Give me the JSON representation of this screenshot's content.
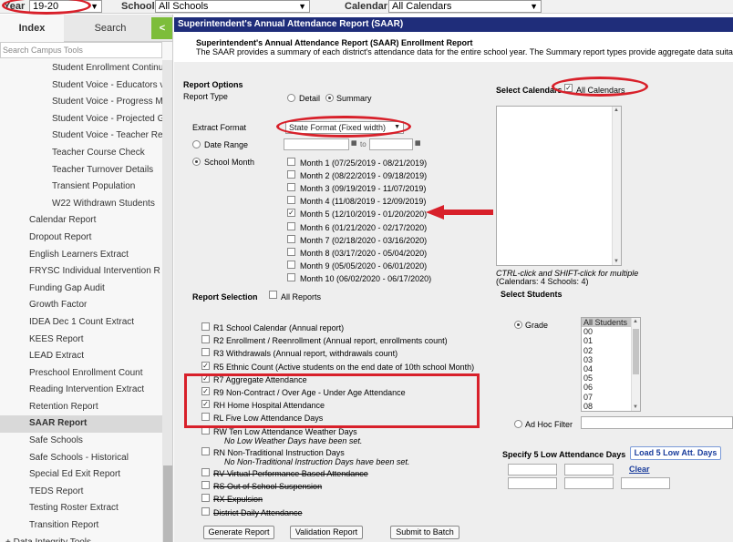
{
  "topbar": {
    "year_label": "Year",
    "year_value": "19-20",
    "school_label": "School",
    "school_value": "All Schools",
    "calendar_label": "Calendar",
    "calendar_value": "All Calendars"
  },
  "sidebar": {
    "tab_index": "Index",
    "tab_search": "Search",
    "collapse_glyph": "<",
    "search_placeholder": "Search Campus Tools",
    "items": [
      {
        "label": "Student Enrollment Continu",
        "level": 2
      },
      {
        "label": "Student Voice - Educators v",
        "level": 2
      },
      {
        "label": "Student Voice - Progress M",
        "level": 2
      },
      {
        "label": "Student Voice - Projected G",
        "level": 2
      },
      {
        "label": "Student Voice - Teacher Re",
        "level": 2
      },
      {
        "label": "Teacher Course Check",
        "level": 2
      },
      {
        "label": "Teacher Turnover Details",
        "level": 2
      },
      {
        "label": "Transient Population",
        "level": 2
      },
      {
        "label": "W22 Withdrawn Students",
        "level": 2
      },
      {
        "label": "Calendar Report",
        "level": 1
      },
      {
        "label": "Dropout Report",
        "level": 1
      },
      {
        "label": "English Learners Extract",
        "level": 1
      },
      {
        "label": "FRYSC Individual Intervention R",
        "level": 1
      },
      {
        "label": "Funding Gap Audit",
        "level": 1
      },
      {
        "label": "Growth Factor",
        "level": 1
      },
      {
        "label": "IDEA Dec 1 Count Extract",
        "level": 1
      },
      {
        "label": "KEES Report",
        "level": 1
      },
      {
        "label": "LEAD Extract",
        "level": 1
      },
      {
        "label": "Preschool Enrollment Count",
        "level": 1
      },
      {
        "label": "Reading Intervention Extract",
        "level": 1
      },
      {
        "label": "Retention Report",
        "level": 1
      },
      {
        "label": "SAAR Report",
        "level": 1,
        "active": true
      },
      {
        "label": "Safe Schools",
        "level": 1
      },
      {
        "label": "Safe Schools - Historical",
        "level": 1
      },
      {
        "label": "Special Ed Exit Report",
        "level": 1
      },
      {
        "label": "TEDS Report",
        "level": 1
      },
      {
        "label": "Testing Roster Extract",
        "level": 1
      },
      {
        "label": "Transition Report",
        "level": 1
      },
      {
        "label": "+ Data Integrity Tools",
        "level": 0
      }
    ]
  },
  "main": {
    "title": "Superintendent's Annual Attendance Report (SAAR)",
    "subtitle": "Superintendent's Annual Attendance Report (SAAR) Enrollment Report",
    "description": "The SAAR provides a summary of each district's attendance data for the entire school year. The Summary report types provide aggregate data suitable",
    "report_options_heading": "Report Options",
    "report_type_label": "Report Type",
    "report_type_detail": "Detail",
    "report_type_summary": "Summary",
    "extract_format_label": "Extract Format",
    "extract_format_value": "State Format (Fixed width)",
    "date_range_label": "Date Range",
    "date_to_label": "to",
    "school_month_label": "School Month",
    "months": [
      {
        "label": "Month 1 (07/25/2019 - 08/21/2019)",
        "checked": false
      },
      {
        "label": "Month 2 (08/22/2019 - 09/18/2019)",
        "checked": false
      },
      {
        "label": "Month 3 (09/19/2019 - 11/07/2019)",
        "checked": false
      },
      {
        "label": "Month 4 (11/08/2019 - 12/09/2019)",
        "checked": false
      },
      {
        "label": "Month 5 (12/10/2019 - 01/20/2020)",
        "checked": true
      },
      {
        "label": "Month 6 (01/21/2020 - 02/17/2020)",
        "checked": false
      },
      {
        "label": "Month 7 (02/18/2020 - 03/16/2020)",
        "checked": false
      },
      {
        "label": "Month 8 (03/17/2020 - 05/04/2020)",
        "checked": false
      },
      {
        "label": "Month 9 (05/05/2020 - 06/01/2020)",
        "checked": false
      },
      {
        "label": "Month 10 (06/02/2020 - 06/17/2020)",
        "checked": false
      }
    ],
    "report_selection_label": "Report Selection",
    "all_reports_label": "All Reports",
    "reports": [
      {
        "label": "R1 School Calendar (Annual report)",
        "checked": false,
        "strike": false
      },
      {
        "label": "R2 Enrollment / Reenrollment (Annual report, enrollments count)",
        "checked": false,
        "strike": false
      },
      {
        "label": "R3 Withdrawals (Annual report, withdrawals count)",
        "checked": false,
        "strike": false
      },
      {
        "label": "R5 Ethnic Count (Active students on the end date of 10th school Month)",
        "checked": true,
        "strike": false
      },
      {
        "label": "R7 Aggregate Attendance",
        "checked": true,
        "strike": false
      },
      {
        "label": "R9 Non-Contract / Over Age - Under Age Attendance",
        "checked": true,
        "strike": false
      },
      {
        "label": "RH Home Hospital Attendance",
        "checked": true,
        "strike": false
      },
      {
        "label": "RL Five Low Attendance Days",
        "checked": false,
        "strike": false
      },
      {
        "label": "RW Ten Low Attendance Weather Days",
        "checked": false,
        "strike": false,
        "note": "No Low Weather Days have been set."
      },
      {
        "label": "RN Non-Traditional Instruction Days",
        "checked": false,
        "strike": false,
        "note": "No Non-Traditional Instruction Days have been set."
      },
      {
        "label": "RV Virtual Performance Based Attendance",
        "checked": false,
        "strike": true
      },
      {
        "label": "RS Out of School Suspension",
        "checked": false,
        "strike": true
      },
      {
        "label": "RX Expulsion",
        "checked": false,
        "strike": true
      },
      {
        "label": "District Daily Attendance",
        "checked": false,
        "strike": true
      }
    ],
    "select_calendars_label": "Select Calendars",
    "all_calendars_label": "All Calendars",
    "calendar_hint": "CTRL-click and SHIFT-click for multiple",
    "calendar_counts": "(Calendars: 4  Schools: 4)",
    "select_students_label": "Select Students",
    "grade_label": "Grade",
    "grades": [
      "All Students",
      "00",
      "01",
      "02",
      "03",
      "04",
      "05",
      "06",
      "07",
      "08"
    ],
    "ad_hoc_label": "Ad Hoc Filter",
    "low_days_label": "Specify 5 Low Attendance Days",
    "load_low_days_button": "Load 5 Low Att. Days",
    "clear_link": "Clear",
    "buttons": {
      "generate": "Generate Report",
      "validation": "Validation Report",
      "batch": "Submit to Batch"
    }
  },
  "colors": {
    "title_bar": "#1f2d7a",
    "annotation_red": "#d8202a",
    "collapse_green": "#7dbd3a"
  }
}
